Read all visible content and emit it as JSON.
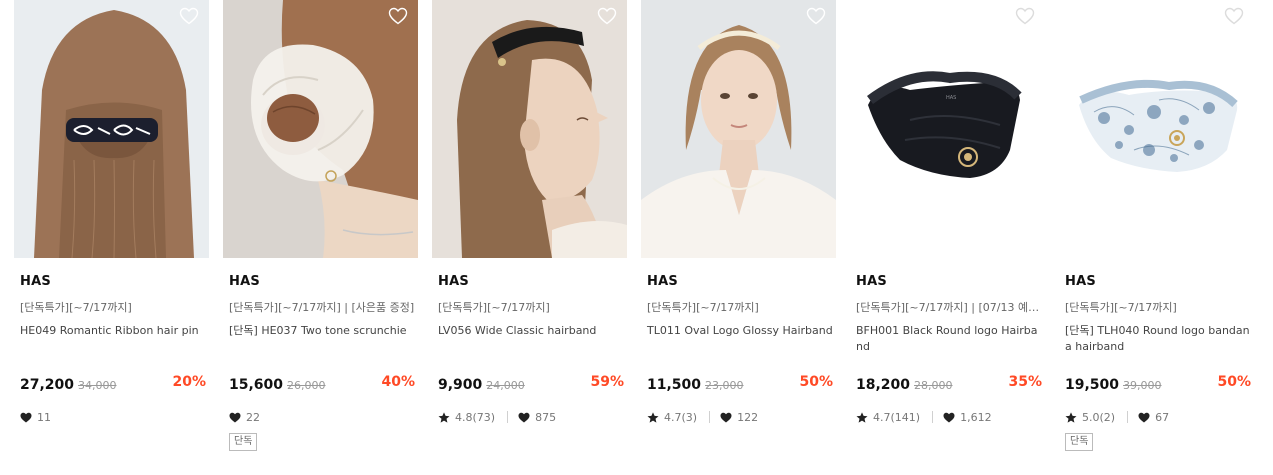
{
  "products": [
    {
      "brand": "HAS",
      "promo": "[단독특가][~7/17까지]",
      "title": "HE049 Romantic Ribbon hair pin",
      "price": "27,200",
      "original_price": "34,000",
      "discount": "20%",
      "likes": "11",
      "image": "hair-pin-photo"
    },
    {
      "brand": "HAS",
      "promo": "[단독특가][~7/17까지] | [사은품 증정]",
      "title": "[단독] HE037 Two tone scrunchie",
      "price": "15,600",
      "original_price": "26,000",
      "discount": "40%",
      "likes": "22",
      "badge": "단독",
      "image": "scrunchie-photo"
    },
    {
      "brand": "HAS",
      "promo": "[단독특가][~7/17까지]",
      "title": "LV056 Wide Classic hairband",
      "price": "9,900",
      "original_price": "24,000",
      "discount": "59%",
      "rating": "4.8(73)",
      "likes": "875",
      "image": "wide-hairband-photo"
    },
    {
      "brand": "HAS",
      "promo": "[단독특가][~7/17까지]",
      "title": "TL011 Oval Logo Glossy Hairband",
      "price": "11,500",
      "original_price": "23,000",
      "discount": "50%",
      "rating": "4.7(3)",
      "likes": "122",
      "image": "glossy-hairband-photo"
    },
    {
      "brand": "HAS",
      "promo": "[단독특가][~7/17까지] | [07/13 예약…",
      "title": "BFH001 Black Round logo Hairband",
      "price": "18,200",
      "original_price": "28,000",
      "discount": "35%",
      "rating": "4.7(141)",
      "likes": "1,612",
      "image": "black-hairband-photo",
      "image_text": "HAS"
    },
    {
      "brand": "HAS",
      "promo": "[단독특가][~7/17까지]",
      "title": "[단독] TLH040 Round logo bandana hairband",
      "price": "19,500",
      "original_price": "39,000",
      "discount": "50%",
      "rating": "5.0(2)",
      "likes": "67",
      "badge": "단독",
      "image": "bandana-hairband-photo"
    }
  ],
  "colors": {
    "discount": "#ff4a26",
    "price": "#111111",
    "muted": "#999999"
  },
  "icons": {
    "wishlist": "heart-outline-icon",
    "likes": "heart-filled-icon",
    "rating": "star-icon"
  }
}
